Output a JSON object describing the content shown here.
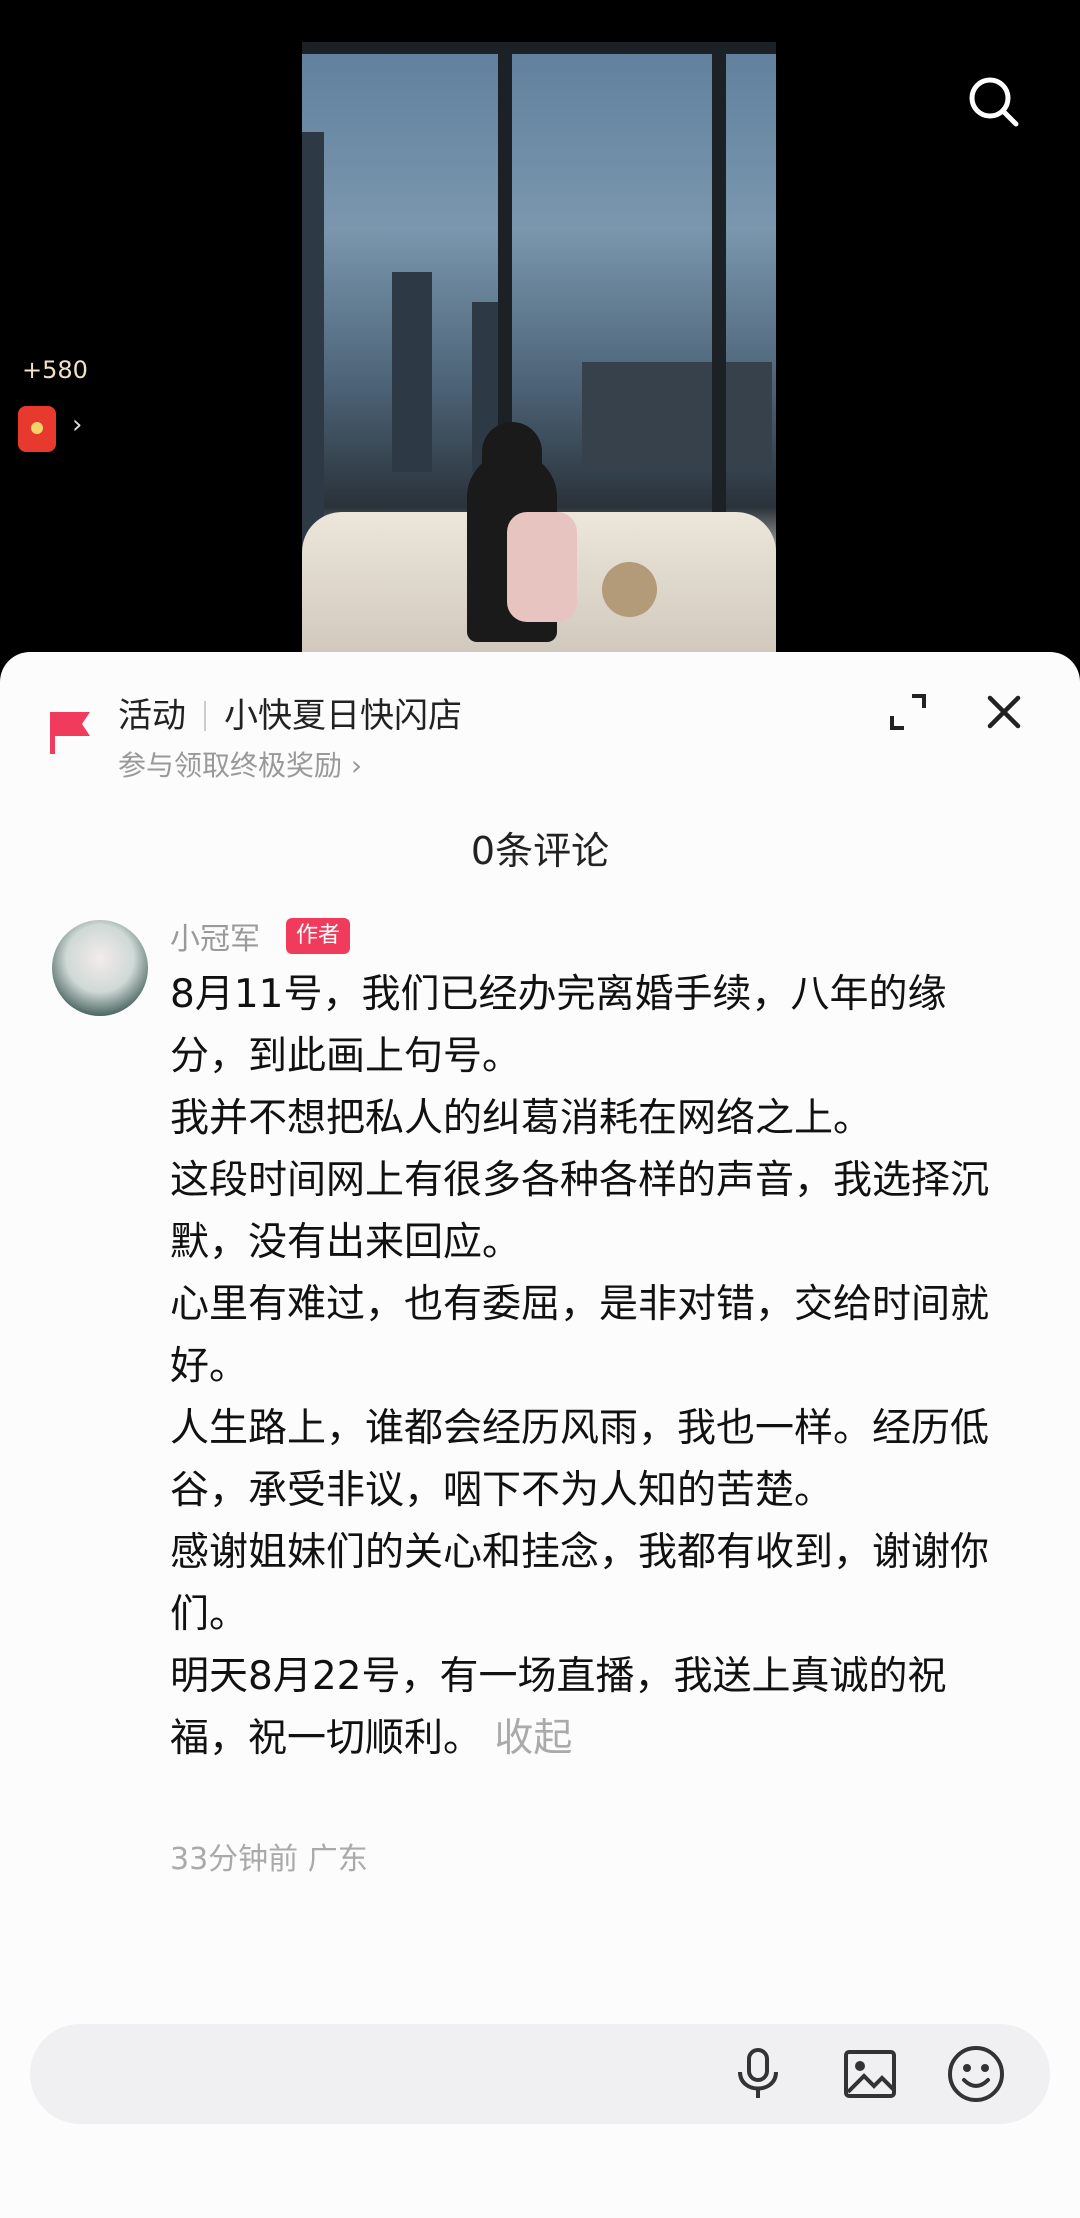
{
  "coins": {
    "amount": "+580"
  },
  "activity": {
    "tag": "活动",
    "name": "小快夏日快闪店",
    "subtitle": "参与领取终极奖励 ›"
  },
  "comments_header": {
    "count_label": "0条评论"
  },
  "comment": {
    "username": "小冠军",
    "badge": "作者",
    "paragraphs": [
      "8月11号，我们已经办完离婚手续，八年的缘分，到此画上句号。",
      "我并不想把私人的纠葛消耗在网络之上。",
      "这段时间网上有很多各种各样的声音，我选择沉默，没有出来回应。",
      "心里有难过，也有委屈，是非对错，交给时间就好。",
      "人生路上，谁都会经历风雨，我也一样。经历低谷，承受非议，咽下不为人知的苦楚。",
      "感谢姐妹们的关心和挂念，我都有收到，谢谢你们。",
      "明天8月22号，有一场直播，我送上真诚的祝福，祝一切顺利。"
    ],
    "collapse_label": "收起",
    "meta": "33分钟前 广东"
  },
  "input": {
    "placeholder": ""
  },
  "colors": {
    "accent": "#f03b5c",
    "sheet_bg": "#fcfcfd"
  },
  "icons": [
    "search-icon",
    "red-packet-icon",
    "flag-icon",
    "expand-icon",
    "close-icon",
    "mic-icon",
    "image-icon",
    "emoji-icon"
  ]
}
